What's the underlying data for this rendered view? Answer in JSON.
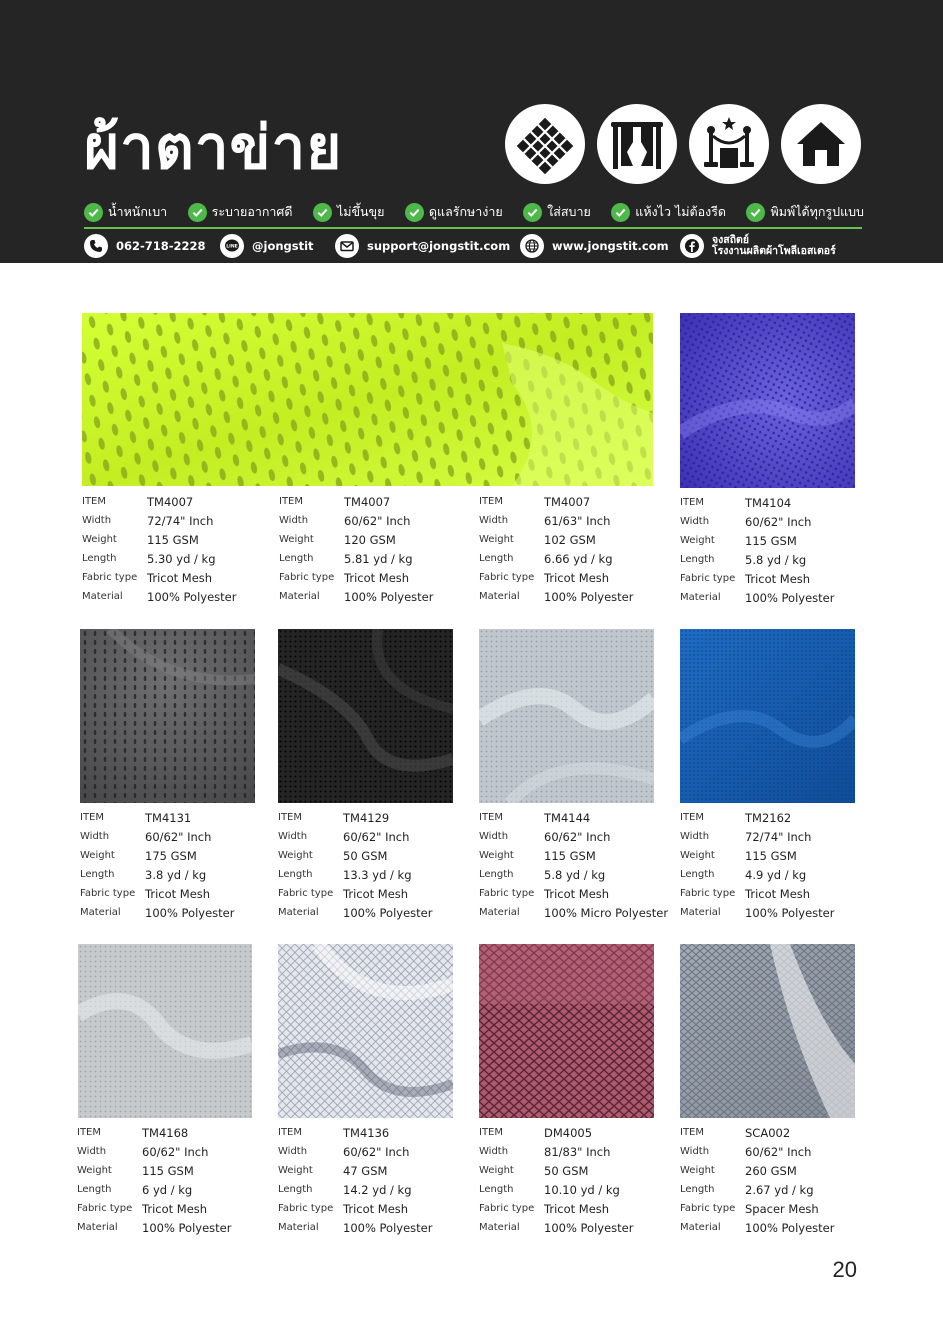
{
  "header": {
    "title": "ผ้าตาข่าย",
    "use_icons": [
      "mesh-fabric-icon",
      "curtain-icon",
      "stanchion-barrier-icon",
      "house-icon"
    ],
    "features": [
      {
        "label": "น้ำหนักเบา"
      },
      {
        "label": "ระบายอากาศดี"
      },
      {
        "label": "ไม่ขึ้นขุย"
      },
      {
        "label": "ดูแลรักษาง่าย"
      },
      {
        "label": "ใส่สบาย"
      },
      {
        "label": "แห้งไว ไม่ต้องรีด"
      },
      {
        "label": "พิมพ์ได้ทุกรูปแบบ"
      }
    ],
    "contacts": {
      "phone": "062-718-2228",
      "line": "@jongstit",
      "line_badge": "LINE",
      "email": "support@jongstit.com",
      "website": "www.jongstit.com",
      "facebook_line1": "จงสถิตย์",
      "facebook_line2": "โรงงานผลิตผ้าโพลีเอสเตอร์"
    },
    "colors": {
      "background": "#252525",
      "accent": "#4fb84a"
    }
  },
  "spec_labels": {
    "item": "ITEM",
    "width": "Width",
    "weight": "Weight",
    "length": "Length",
    "fabric_type": "Fabric type",
    "material": "Material"
  },
  "products": [
    {
      "item": "TM4007",
      "width": "72/74\" Inch",
      "weight": "115 GSM",
      "length": "5.30 yd / kg",
      "fabric_type": "Tricot Mesh",
      "material": "100% Polyester",
      "swatch_color": "#c8f52a"
    },
    {
      "item": "TM4007",
      "width": "60/62\" Inch",
      "weight": "120 GSM",
      "length": "5.81 yd / kg",
      "fabric_type": "Tricot Mesh",
      "material": "100% Polyester",
      "swatch_color": "#c8f52a"
    },
    {
      "item": "TM4007",
      "width": "61/63\" Inch",
      "weight": "102 GSM",
      "length": "6.66 yd / kg",
      "fabric_type": "Tricot Mesh",
      "material": "100% Polyester",
      "swatch_color": "#c8f52a"
    },
    {
      "item": "TM4104",
      "width": "60/62\" Inch",
      "weight": "115 GSM",
      "length": "5.8 yd / kg",
      "fabric_type": "Tricot Mesh",
      "material": "100% Polyester",
      "swatch_color": "#4a3fc4"
    },
    {
      "item": "TM4131",
      "width": "60/62\" Inch",
      "weight": "175 GSM",
      "length": "3.8 yd / kg",
      "fabric_type": "Tricot Mesh",
      "material": "100% Polyester",
      "swatch_color": "#5a5a5c"
    },
    {
      "item": "TM4129",
      "width": "60/62\" Inch",
      "weight": "50 GSM",
      "length": "13.3 yd / kg",
      "fabric_type": "Tricot Mesh",
      "material": "100% Polyester",
      "swatch_color": "#1c1c1c"
    },
    {
      "item": "TM4144",
      "width": "60/62\" Inch",
      "weight": "115 GSM",
      "length": "5.8 yd / kg",
      "fabric_type": "Tricot Mesh",
      "material": "100% Micro Polyester",
      "swatch_color": "#b7bfc6"
    },
    {
      "item": "TM2162",
      "width": "72/74\" Inch",
      "weight": "115 GSM",
      "length": "4.9 yd / kg",
      "fabric_type": "Tricot Mesh",
      "material": "100% Polyester",
      "swatch_color": "#1658a8"
    },
    {
      "item": "TM4168",
      "width": "60/62\" Inch",
      "weight": "115 GSM",
      "length": "6 yd / kg",
      "fabric_type": "Tricot Mesh",
      "material": "100% Polyester",
      "swatch_color": "#c4c8cb"
    },
    {
      "item": "TM4136",
      "width": "60/62\" Inch",
      "weight": "47 GSM",
      "length": "14.2 yd / kg",
      "fabric_type": "Tricot Mesh",
      "material": "100% Polyester",
      "swatch_color": "#dfe3ea"
    },
    {
      "item": "DM4005",
      "width": "81/83\" Inch",
      "weight": "50 GSM",
      "length": "10.10 yd / kg",
      "fabric_type": "Tricot Mesh",
      "material": "100% Polyester",
      "swatch_color": "#a8566b"
    },
    {
      "item": "SCA002",
      "width": "60/62\" Inch",
      "weight": "260 GSM",
      "length": "2.67 yd / kg",
      "fabric_type": "Spacer Mesh",
      "material": "100% Polyester",
      "swatch_color": "#8f97a3"
    }
  ],
  "page_number": "20"
}
